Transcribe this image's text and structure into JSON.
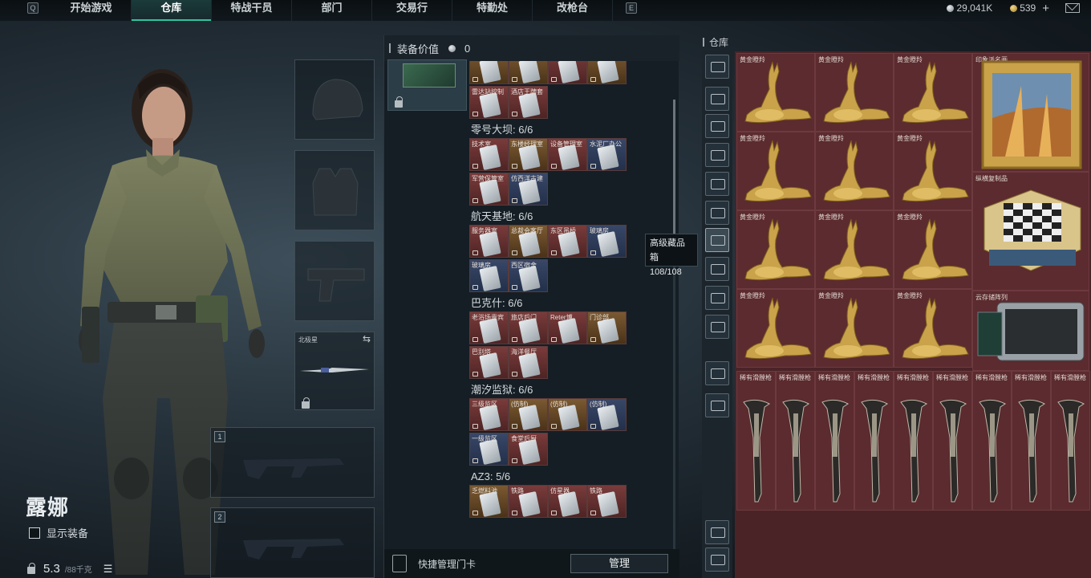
{
  "topbar": {
    "left_key": "Q",
    "right_key": "E",
    "tabs": [
      "开始游戏",
      "仓库",
      "特战干员",
      "部门",
      "交易行",
      "特勤处",
      "改枪台"
    ],
    "active_tab": "仓库",
    "silver": "29,041K",
    "gold": "539",
    "plus": "+"
  },
  "character": {
    "name": "露娜",
    "show_gear_label": "显示装备",
    "weight_value": "5.3",
    "weight_max": "/88千克"
  },
  "slots": {
    "melee_label": "北极星",
    "gun1_num": "1",
    "gun2_num": "2"
  },
  "middle": {
    "header": "装备价值",
    "value": "0",
    "groups": [
      {
        "title": "",
        "cards": [
          {
            "name": "",
            "color": "gold"
          },
          {
            "name": "",
            "color": "gold"
          },
          {
            "name": "",
            "color": "red"
          },
          {
            "name": "",
            "color": "gold"
          },
          {
            "name": "雷达站控制",
            "color": "red"
          },
          {
            "name": "酒店王牌套",
            "color": "red"
          }
        ]
      },
      {
        "title": "零号大坝: 6/6",
        "cards": [
          {
            "name": "技术室",
            "color": "red"
          },
          {
            "name": "东楼经理室",
            "color": "gold"
          },
          {
            "name": "设备管理室",
            "color": "red"
          },
          {
            "name": "水泥厂办公",
            "color": "blue"
          },
          {
            "name": "军营保管室",
            "color": "red"
          },
          {
            "name": "仿西洋古建",
            "color": "blue"
          }
        ]
      },
      {
        "title": "航天基地: 6/6",
        "cards": [
          {
            "name": "服务器室",
            "color": "red"
          },
          {
            "name": "总裁会客厅",
            "color": "gold"
          },
          {
            "name": "东区吊桥",
            "color": "red"
          },
          {
            "name": "玻璃房",
            "color": "blue"
          },
          {
            "name": "玻璃房",
            "color": "blue"
          },
          {
            "name": "西区宿舍",
            "color": "blue"
          }
        ]
      },
      {
        "title": "巴克什: 6/6",
        "cards": [
          {
            "name": "老浴场贵宾",
            "color": "red"
          },
          {
            "name": "旅店后门",
            "color": "red"
          },
          {
            "name": "Reter博",
            "color": "red"
          },
          {
            "name": "门诊部",
            "color": "gold"
          },
          {
            "name": "巴别塔",
            "color": "red"
          },
          {
            "name": "海洋餐厅",
            "color": "red"
          }
        ]
      },
      {
        "title": "潮汐监狱: 6/6",
        "cards": [
          {
            "name": "三级监区",
            "color": "red"
          },
          {
            "name": "(仿制)",
            "color": "gold"
          },
          {
            "name": "(仿制)",
            "color": "gold"
          },
          {
            "name": "(仿制)",
            "color": "blue"
          },
          {
            "name": "一级监区",
            "color": "blue"
          },
          {
            "name": "食堂后厨",
            "color": "red"
          }
        ]
      },
      {
        "title": "AZ3: 5/6",
        "cards": [
          {
            "name": "乏燃料池",
            "color": "gold"
          },
          {
            "name": "铁路",
            "color": "red"
          },
          {
            "name": "仿星器",
            "color": "red"
          },
          {
            "name": "铁路",
            "color": "red"
          }
        ]
      }
    ],
    "footer_label": "快捷管理门卡",
    "manage_button": "管理",
    "tooltip_title": "高级藏品箱",
    "tooltip_count": "108/108"
  },
  "warehouse": {
    "title": "仓库",
    "rail_icons": [
      "crate-icon",
      "gti-1-icon",
      "gti-2-icon",
      "v-1-icon",
      "v-2-icon",
      "v-3-icon",
      "v-4-icon",
      "gti-3-icon",
      "gti-4-icon",
      "v-5-icon",
      "tag-icon",
      "settings-icon",
      "layers-icon",
      "sort-icon"
    ],
    "selected_rail": 6,
    "deer_label": "黄金瞪羚",
    "painting_label": "印象派名画",
    "chess_label": "纵横复制品",
    "server_label": "云存储阵列",
    "musket_label": "稀有滑膛枪",
    "deer_count": 12,
    "musket_count": 9
  },
  "colors": {
    "accent": "#2ec4a0",
    "warehouse_bg": "#4a2327",
    "cell_bg": "#5b2b2f",
    "gold_item": "#c9a24a"
  }
}
